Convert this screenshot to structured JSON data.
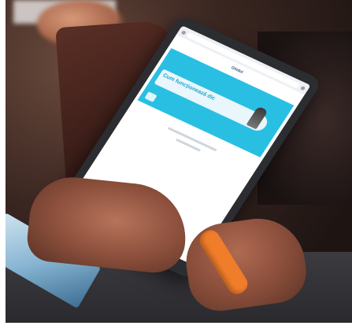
{
  "tablet": {
    "url": "",
    "site_name": "Ghidul",
    "banner_text": "Cum funcționează dic",
    "footer_text": ""
  },
  "colors": {
    "banner": "#29bfe3",
    "wristband": "#f07d2a",
    "tablet_frame": "#2b2d31"
  },
  "icons": [
    "browser-menu-icon",
    "home-icon",
    "android-nav-icon"
  ]
}
